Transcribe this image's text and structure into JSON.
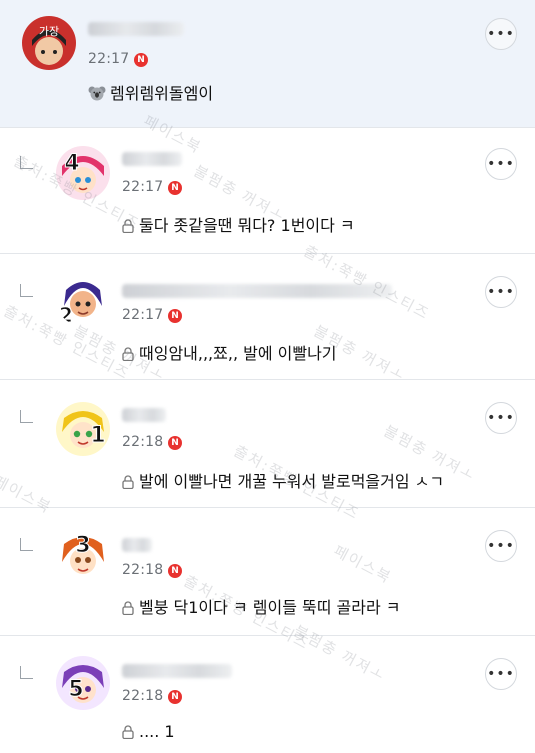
{
  "main_comment": {
    "time": "22:17",
    "badge": "N",
    "text": "렘위렘위돌엠이",
    "avatar_label": "가장"
  },
  "replies": [
    {
      "time": "22:17",
      "badge": "N",
      "text": "둘다 좃같을땐 뭐다? 1번이다 ㅋ",
      "avatar_number": "4"
    },
    {
      "time": "22:17",
      "badge": "N",
      "text": "때잉암내,,,쬬,, 발에 이빨나기",
      "avatar_number": "2"
    },
    {
      "time": "22:18",
      "badge": "N",
      "text": "발에 이빨나면 개꿀 누워서 발로먹을거임 ㅅㄱ",
      "avatar_number": "1"
    },
    {
      "time": "22:18",
      "badge": "N",
      "text": "벨붕 닥1이다 ㅋ 렘이들 뚝띠 골라라 ㅋ",
      "avatar_number": "3"
    },
    {
      "time": "22:18",
      "badge": "N",
      "text": ".... 1",
      "avatar_number": "5"
    }
  ],
  "more_label": "•••",
  "watermark": {
    "line1": "출처:쭉빵 인스티즈",
    "line2": "페이스북",
    "line3": "불펌충 꺼져ㅗ"
  }
}
